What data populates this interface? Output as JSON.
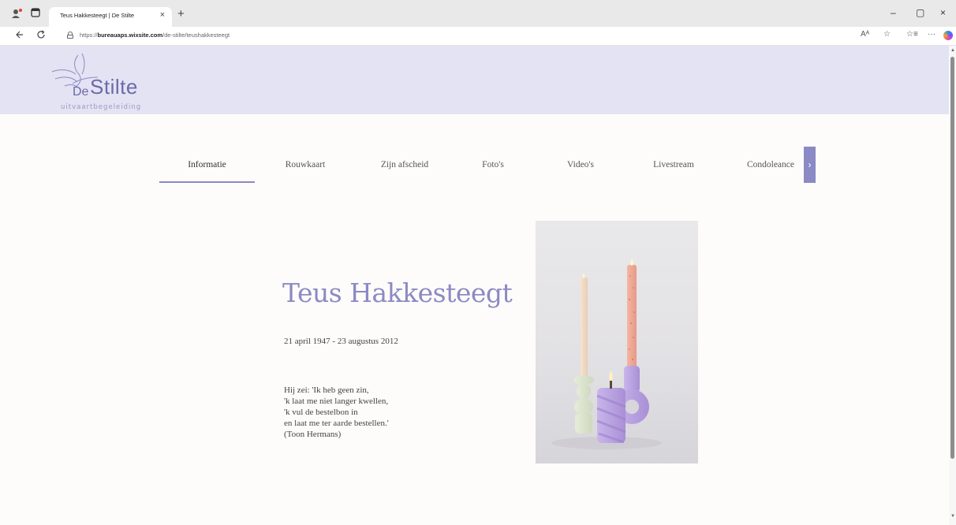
{
  "browser": {
    "tab_title": "Teus Hakkesteegt | De Stilte",
    "tab_close": "×",
    "new_tab": "+",
    "window_controls": {
      "minimize": "–",
      "maximize": "▢",
      "close": "×"
    },
    "url_prefix": "https://",
    "url_domain": "bureauaps.wixsite.com",
    "url_path": "/de-stilte/teushakkesteegt",
    "icons": [
      "profile-icon",
      "tab-actions-icon",
      "back-icon",
      "reload-icon",
      "lock-icon",
      "read-aloud-icon",
      "favorite-star-icon",
      "favorites-icon",
      "more-icon",
      "copilot-icon"
    ],
    "read_aloud": "Aᴬ",
    "favorite": "☆",
    "favorites": "☆≡",
    "more": "···"
  },
  "header": {
    "logo_de": "De",
    "logo_stilte": "Stilte",
    "logo_sub": "uitvaartbegeleiding",
    "background": "#e3e3f3"
  },
  "menu": {
    "items": [
      {
        "label": "Informatie",
        "active": true
      },
      {
        "label": "Rouwkaart"
      },
      {
        "label": "Zijn afscheid"
      },
      {
        "label": "Foto's"
      },
      {
        "label": "Video's"
      },
      {
        "label": "Livestream"
      },
      {
        "label": "Condoleance"
      }
    ],
    "arrow": "›",
    "accent": "#8b8ac4"
  },
  "main": {
    "name": "Teus Hakkesteegt",
    "dates": "21 april 1947 - 23 augustus 2012",
    "poem": [
      "Hij zei: 'Ik heb geen zin,",
      "'k laat me niet langer kwellen,",
      "'k vul de bestelbon in",
      "en laat me ter aarde bestellen.'",
      "(Toon Hermans)"
    ],
    "photo_icon": "candles-photo"
  }
}
